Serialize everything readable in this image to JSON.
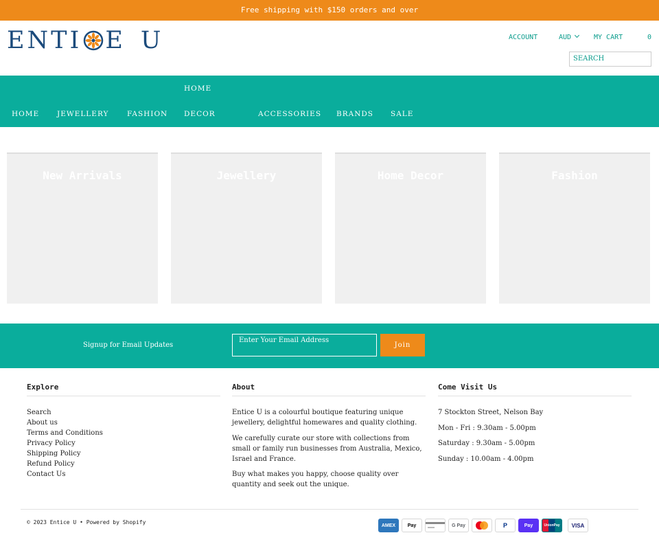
{
  "announcement": "Free shipping with $150 orders and over",
  "logo": {
    "text_start": "ENTI",
    "text_mid": "E",
    "text_end": "U"
  },
  "header": {
    "account": "ACCOUNT",
    "currency": "AUD",
    "cart": "MY CART",
    "cart_count": "0",
    "search_placeholder": "SEARCH"
  },
  "nav": {
    "home_top": "HOME",
    "items": [
      "HOME",
      "JEWELLERY",
      "FASHION",
      "DECOR",
      "ACCESSORIES",
      "BRANDS",
      "SALE"
    ]
  },
  "tiles": [
    "New Arrivals",
    "Jewellery",
    "Home Decor",
    "Fashion"
  ],
  "signup": {
    "label": "Signup for Email Updates",
    "placeholder": "Enter Your Email Address",
    "button": "Join"
  },
  "footer": {
    "explore": {
      "title": "Explore",
      "links": [
        "Search",
        "About us",
        "Terms and Conditions",
        "Privacy Policy",
        "Shipping Policy",
        "Refund Policy",
        "Contact Us"
      ]
    },
    "about": {
      "title": "About",
      "paragraphs": [
        "Entice U is a colourful boutique featuring unique jewellery, delightful homewares and quality clothing.",
        "We carefully curate our store with collections from small or family run businesses from Australia, Mexico, Israel and France.",
        "Buy what makes you happy, choose quality over quantity and seek out the unique."
      ]
    },
    "visit": {
      "title": "Come Visit Us",
      "lines": [
        "7 Stockton Street, Nelson Bay",
        "Mon - Fri : 9.30am - 5.00pm",
        "Saturday : 9.30am - 5.00pm",
        "Sunday : 10.00am - 4.00pm"
      ]
    },
    "copyright": "© 2023 Entice U",
    "powered": "Powered by Shopify"
  },
  "payments": [
    {
      "name": "amex-icon",
      "label": "AMEX"
    },
    {
      "name": "apple-pay-icon",
      "label": "Pay"
    },
    {
      "name": "generic-card-icon",
      "label": ""
    },
    {
      "name": "google-pay-icon",
      "label": "G Pay"
    },
    {
      "name": "mastercard-icon",
      "label": ""
    },
    {
      "name": "paypal-icon",
      "label": "P"
    },
    {
      "name": "shop-pay-icon",
      "label": "Pay"
    },
    {
      "name": "unionpay-icon",
      "label": "UnionPay"
    },
    {
      "name": "visa-icon",
      "label": "VISA"
    }
  ],
  "colors": {
    "orange": "#ee8a1a",
    "teal": "#0aad9c",
    "navy": "#1c4b7c"
  }
}
